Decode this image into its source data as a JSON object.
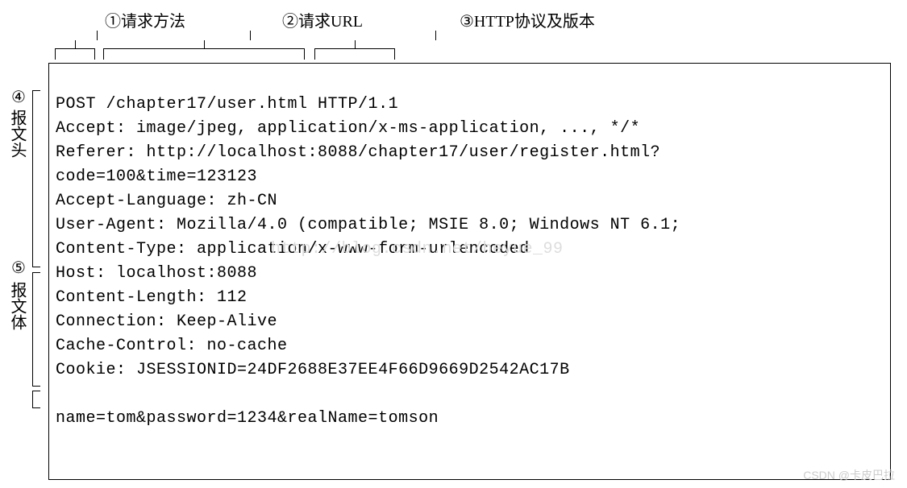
{
  "labels": {
    "l1": "①请求方法",
    "l2": "②请求URL",
    "l3": "③HTTP协议及版本",
    "l4_num": "④",
    "l4_text": "报文头",
    "l5_num": "⑤",
    "l5_text": "报文体"
  },
  "request": {
    "method": "POST",
    "url": "/chapter17/user.html",
    "protocol": "HTTP/1.1",
    "request_line": "POST /chapter17/user.html HTTP/1.1",
    "headers": [
      "Accept: image/jpeg, application/x-ms-application, ..., */*",
      "Referer: http://localhost:8088/chapter17/user/register.html?",
      "code=100&time=123123",
      "Accept-Language: zh-CN",
      "User-Agent: Mozilla/4.0 (compatible; MSIE 8.0; Windows NT 6.1;",
      "Content-Type: application/x-www-form-urlencoded",
      "Host: localhost:8088",
      "Content-Length: 112",
      "Connection: Keep-Alive",
      "Cache-Control: no-cache",
      "Cookie: JSESSIONID=24DF2688E37EE4F66D9669D2542AC17B"
    ],
    "body": "name=tom&password=1234&realName=tomson"
  },
  "watermark": {
    "w1": "http://blog.csdn.net/heyue_99",
    "w2": "CSDN @卡皮巴拉"
  }
}
